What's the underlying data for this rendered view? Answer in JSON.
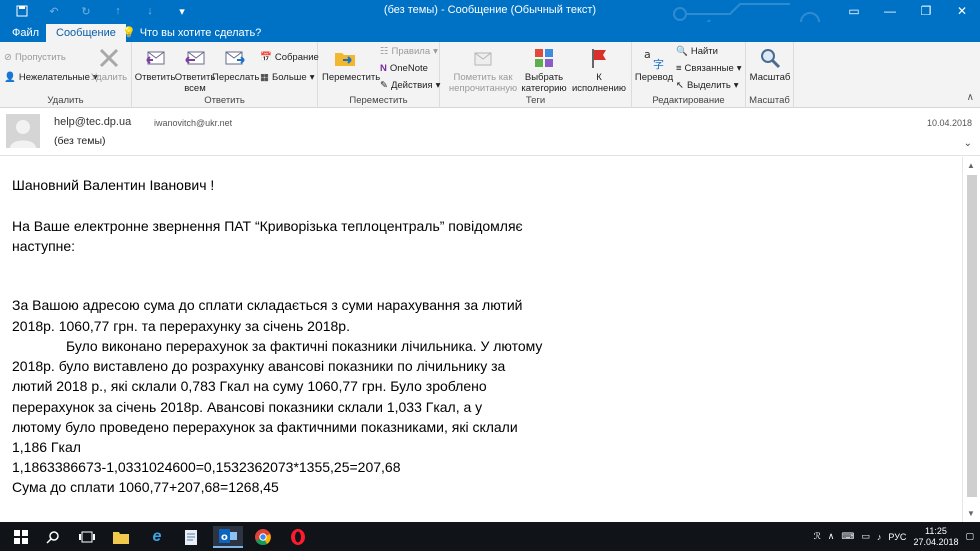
{
  "window": {
    "title": "(без темы) - Сообщение (Обычный текст)",
    "controls": {
      "minimize_icon": "minimize-icon",
      "maximize_icon": "maximize-icon",
      "close_icon": "close-icon"
    }
  },
  "tabs": [
    {
      "label": "Файл"
    },
    {
      "label": "Сообщение"
    }
  ],
  "tell_me": "Что вы хотите сделать?",
  "ribbon": {
    "delete_group": {
      "label": "Удалить",
      "ignore": "Пропустить",
      "junk": "Нежелательные",
      "delete": "Удалить"
    },
    "respond_group": {
      "label": "Ответить",
      "reply": "Ответить",
      "reply_all": "Ответить всем",
      "forward": "Переслать",
      "meeting": "Собрание",
      "more": "Больше"
    },
    "move_group": {
      "label": "Переместить",
      "move": "Переместить",
      "rules": "Правила",
      "onenote": "OneNote",
      "actions": "Действия"
    },
    "tags_group": {
      "label": "Теги",
      "mark_unread": "Пометить как непрочитанную",
      "categorize": "Выбрать категорию",
      "follow_up": "К исполнению"
    },
    "editing_group": {
      "label": "Редактирование",
      "translate": "Перевод",
      "find": "Найти",
      "related": "Связанные",
      "select": "Выделить"
    },
    "zoom_group": {
      "label": "Масштаб",
      "zoom": "Масштаб"
    }
  },
  "header": {
    "from": "help@tec.dp.ua",
    "to": "iwanovitch@ukr.net",
    "subject": "(без темы)",
    "date": "10.04.2018"
  },
  "body": {
    "lines": [
      "Шановний Валентин Іванович !",
      "На Ваше електронне звернення  ПАТ “Криворізька теплоцентраль” повідомляє",
      "наступне:",
      "За Вашою адресою сума до сплати складається з суми нарахування за лютий",
      "2018р. 1060,77 грн. та перерахунку за січень 2018р.",
      "Було виконано перерахунок за фактичні показники лічильника. У лютому",
      "2018р. було виставлено до розрахунку авансові показники по лічильнику за",
      "лютий 2018 р., які склали 0,783 Гкал на суму 1060,77 грн. Було зроблено",
      "перерахунок за січень 2018р. Авансові показники склали 1,033 Гкал, а у",
      "лютому було проведено перерахунок за фактичними показниками, які склали",
      "1,186 Гкал",
      "1,1863386673-1,0331024600=0,1532362073*1355,25=207,68",
      "Сума до сплати 1060,77+207,68=1268,45"
    ]
  },
  "taskbar": {
    "language": "РУС",
    "time": "11:25",
    "date": "27.04.2018"
  }
}
